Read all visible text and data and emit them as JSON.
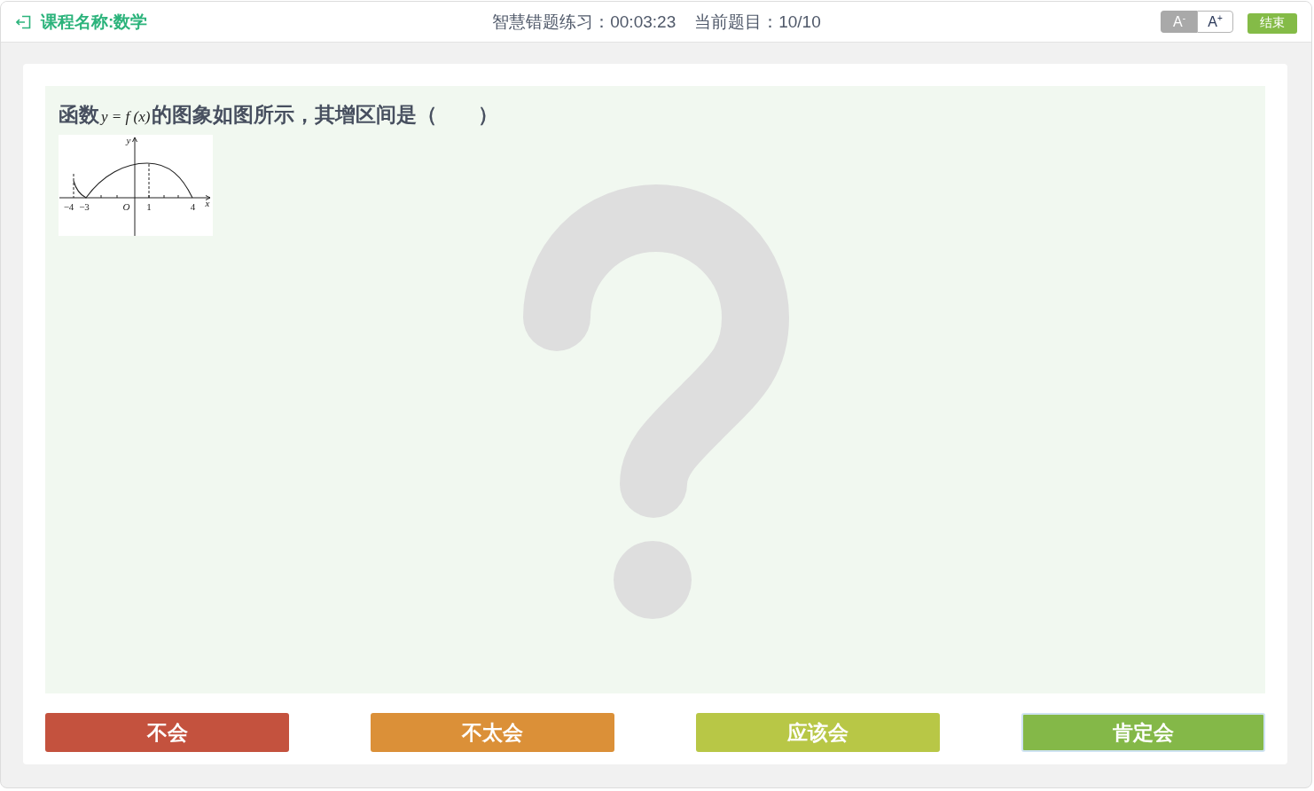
{
  "header": {
    "title": "课程名称:数学",
    "practice_timer": {
      "label": "智慧错题练习：",
      "value": "00:03:23"
    },
    "question_counter": {
      "label": "当前题目：",
      "value": "10/10"
    },
    "font_size_buttons": [
      {
        "label": "A$^{-}$",
        "disabled": true
      },
      {
        "label": "A$^{+}$",
        "disabled": false
      }
    ],
    "end_button": "结束"
  },
  "question": {
    "text_parts": [
      {
        "kind": "text",
        "text": "函数"
      },
      {
        "kind": "formula",
        "text": "y = f (x)"
      },
      {
        "kind": "text",
        "text": "的图象如图所示，其增区间是（　　）"
      }
    ],
    "figure": {
      "y_axis_label": "y",
      "x_axis_label": "x",
      "origin_label": "O",
      "x_tick_labels": [
        "−4",
        "−3",
        "1",
        "4"
      ]
    }
  },
  "answer_buttons": [
    {
      "label": "不会",
      "color": "#c4523e",
      "selected": false
    },
    {
      "label": "不太会",
      "color": "#db9038",
      "selected": false
    },
    {
      "label": "应该会",
      "color": "#b8c746",
      "selected": false
    },
    {
      "label": "肯定会",
      "color": "#84b848",
      "selected": true
    }
  ]
}
